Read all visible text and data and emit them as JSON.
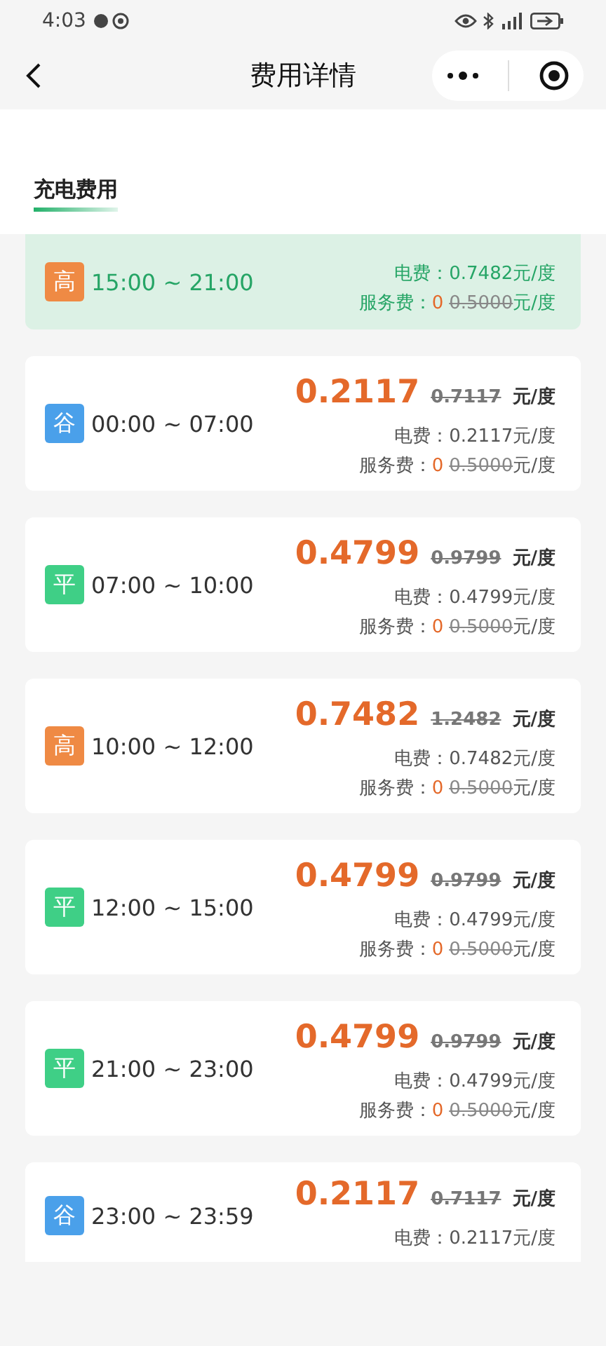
{
  "status_bar": {
    "time": "4:03"
  },
  "nav": {
    "title": "费用详情"
  },
  "section_tab": {
    "label": "充电费用",
    "selected": true
  },
  "periods": [
    {
      "tag": "高",
      "color": "#ef8a44",
      "time": "15:00 ~ 21:00",
      "selected": true,
      "electricity": "电费：0.7482元/度",
      "service_label": "服务费：",
      "service_now": "0",
      "service_old": "0.5000",
      "service_unit": "元/度"
    },
    {
      "tag": "谷",
      "color": "#4aa0ea",
      "time": "00:00 ~ 07:00",
      "selected": false,
      "price": "0.2117",
      "old_price": "0.7117",
      "unit": "元/度",
      "electricity": "电费：0.2117元/度",
      "service_label": "服务费：",
      "service_now": "0",
      "service_old": "0.5000",
      "service_unit": "元/度"
    },
    {
      "tag": "平",
      "color": "#3fcf86",
      "time": "07:00 ~ 10:00",
      "selected": false,
      "price": "0.4799",
      "old_price": "0.9799",
      "unit": "元/度",
      "electricity": "电费：0.4799元/度",
      "service_label": "服务费：",
      "service_now": "0",
      "service_old": "0.5000",
      "service_unit": "元/度"
    },
    {
      "tag": "高",
      "color": "#ef8a44",
      "time": "10:00 ~ 12:00",
      "selected": false,
      "price": "0.7482",
      "old_price": "1.2482",
      "unit": "元/度",
      "electricity": "电费：0.7482元/度",
      "service_label": "服务费：",
      "service_now": "0",
      "service_old": "0.5000",
      "service_unit": "元/度"
    },
    {
      "tag": "平",
      "color": "#3fcf86",
      "time": "12:00 ~ 15:00",
      "selected": false,
      "price": "0.4799",
      "old_price": "0.9799",
      "unit": "元/度",
      "electricity": "电费：0.4799元/度",
      "service_label": "服务费：",
      "service_now": "0",
      "service_old": "0.5000",
      "service_unit": "元/度"
    },
    {
      "tag": "平",
      "color": "#3fcf86",
      "time": "21:00 ~ 23:00",
      "selected": false,
      "price": "0.4799",
      "old_price": "0.9799",
      "unit": "元/度",
      "electricity": "电费：0.4799元/度",
      "service_label": "服务费：",
      "service_now": "0",
      "service_old": "0.5000",
      "service_unit": "元/度"
    },
    {
      "tag": "谷",
      "color": "#4aa0ea",
      "time": "23:00 ~ 23:59",
      "selected": false,
      "price": "0.2117",
      "old_price": "0.7117",
      "unit": "元/度",
      "electricity": "电费：0.2117元/度"
    }
  ]
}
